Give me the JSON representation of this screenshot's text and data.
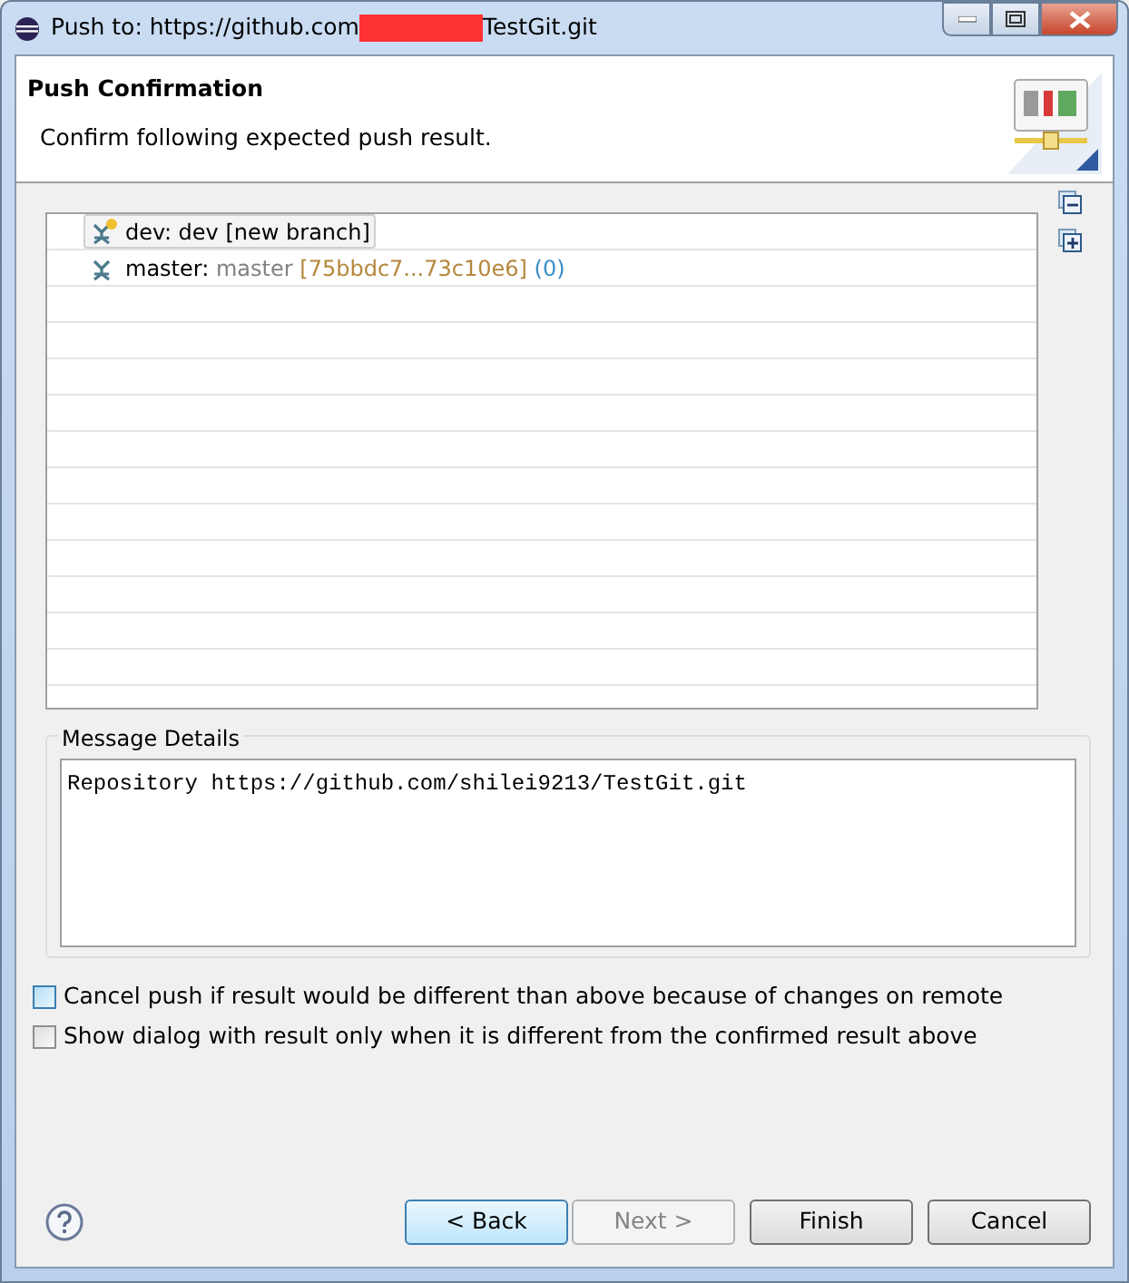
{
  "window": {
    "title_start": "Push to: https://github.com",
    "title_end": "TestGit.git",
    "redacted": true
  },
  "banner": {
    "title": "Push Confirmation",
    "description": "Confirm following expected push result."
  },
  "tree": {
    "rows": [
      {
        "kind": "new",
        "selected": true,
        "parts": [
          {
            "kind": "plain",
            "text": "dev: dev [new branch]"
          }
        ]
      },
      {
        "kind": "existing",
        "selected": false,
        "parts": [
          {
            "kind": "name",
            "text": "master:"
          },
          {
            "kind": "ref",
            "text": "master"
          },
          {
            "kind": "range",
            "text": "[75bbdc7...73c10e6]"
          },
          {
            "kind": "count",
            "text": "(0)"
          }
        ]
      }
    ]
  },
  "message_details": {
    "label": "Message Details",
    "text": "Repository https://github.com/shilei9213/TestGit.git"
  },
  "options": [
    {
      "label": "Cancel push if result would be different than above because of changes on remote",
      "checked": false,
      "focused": true
    },
    {
      "label": "Show dialog with result only when it is different from the confirmed result above",
      "checked": false,
      "focused": false
    }
  ],
  "buttons": [
    {
      "label": "< Back",
      "default": true,
      "disabled": false
    },
    {
      "label": "Next >",
      "default": false,
      "disabled": true
    },
    {
      "label": "Finish",
      "default": false,
      "disabled": false
    },
    {
      "label": "Cancel",
      "default": false,
      "disabled": false
    }
  ]
}
